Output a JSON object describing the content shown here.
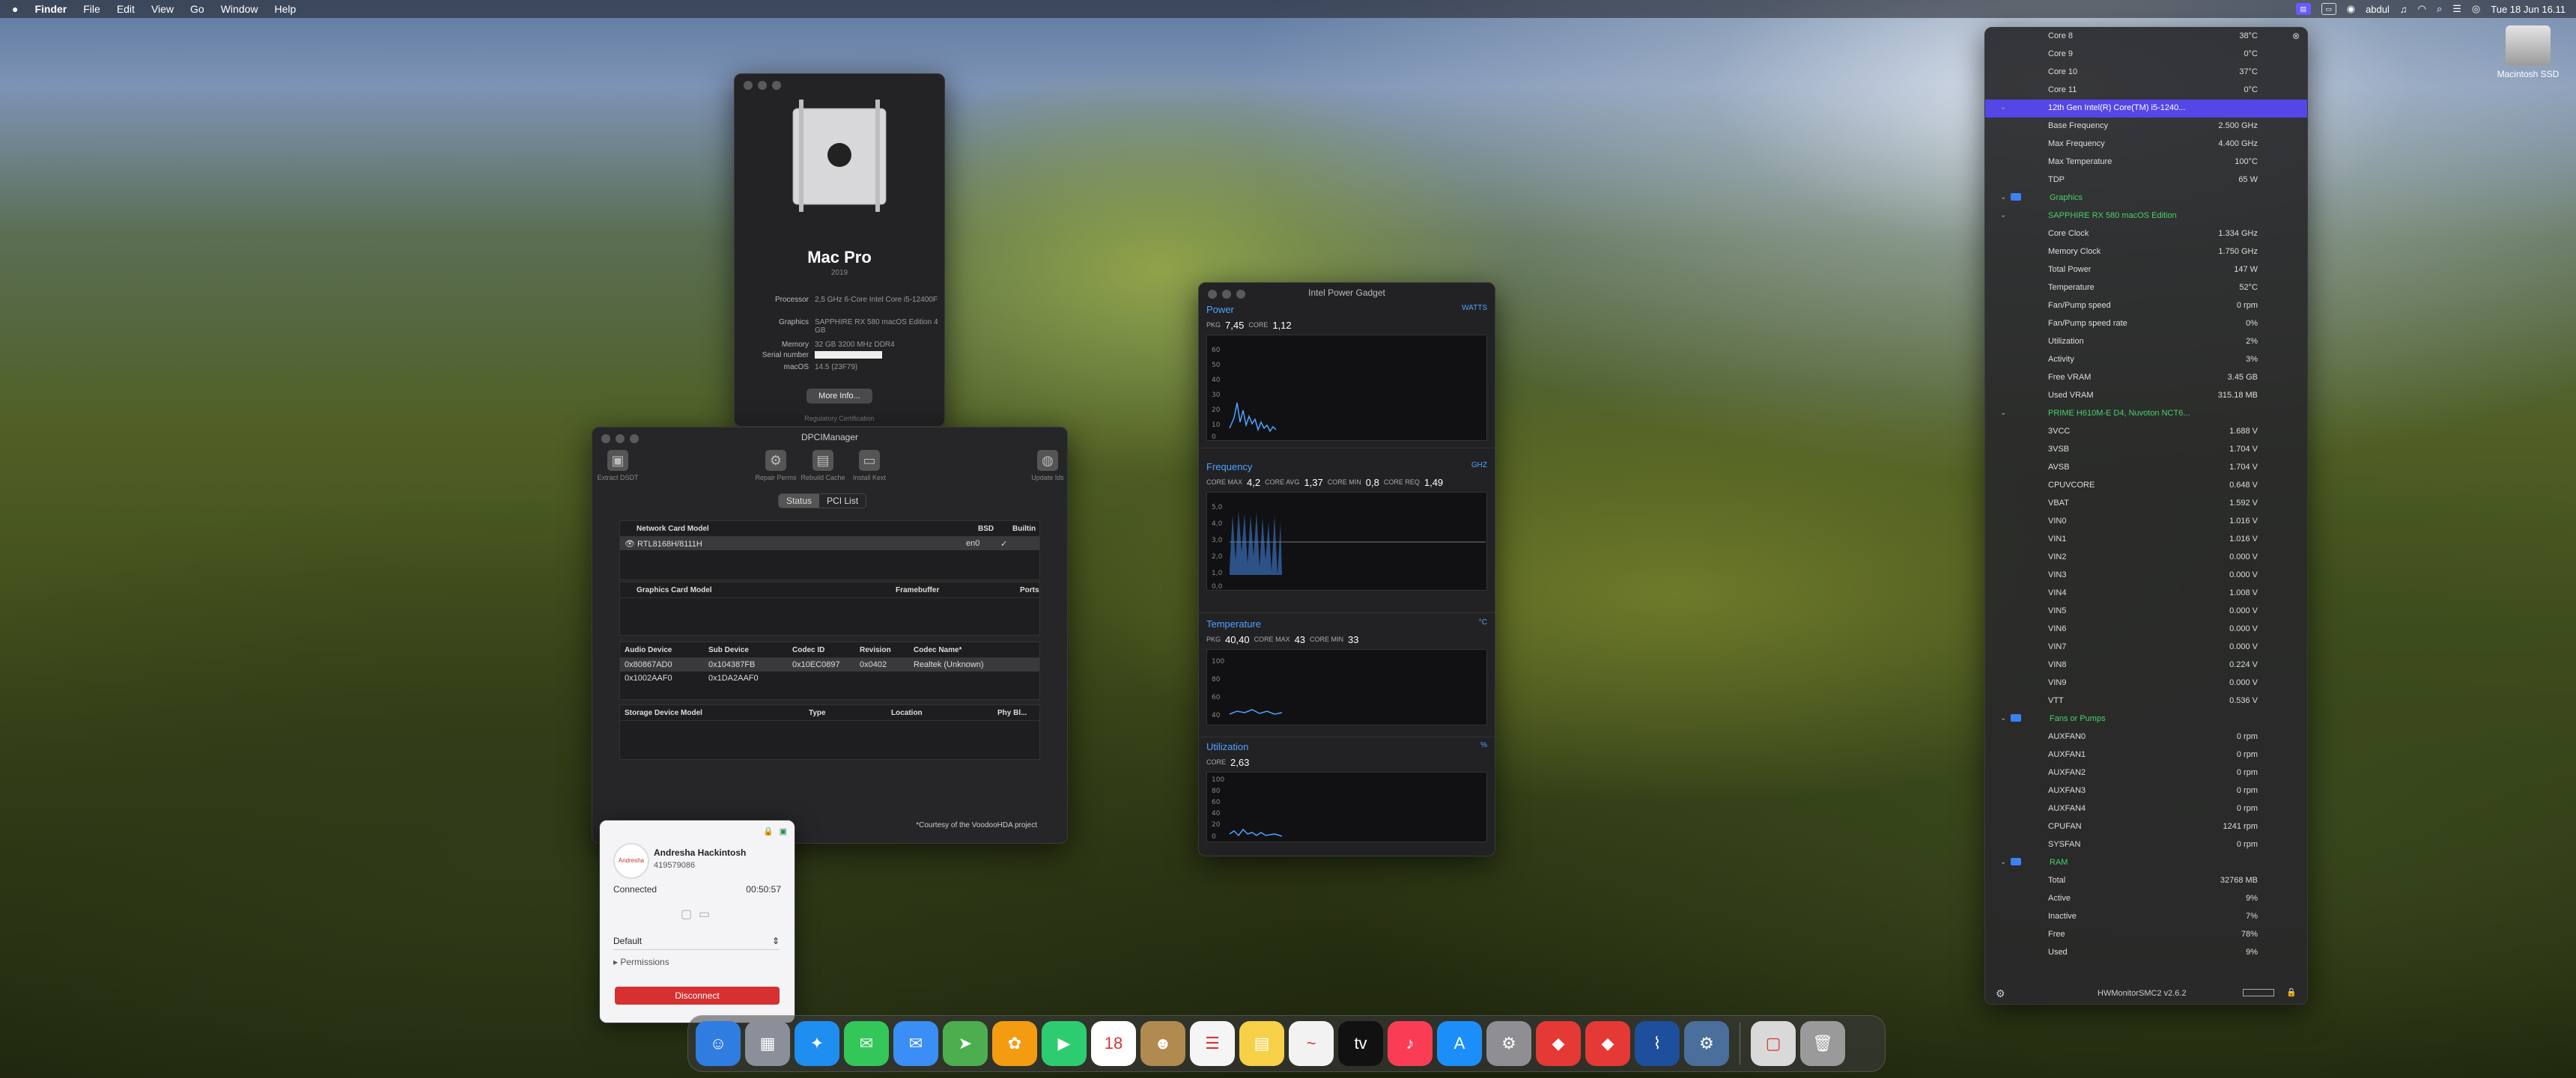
{
  "menubar": {
    "app": "Finder",
    "items": [
      "File",
      "Edit",
      "View",
      "Go",
      "Window",
      "Help"
    ],
    "user": "abdul",
    "clock": "Tue 18 Jun 16.11"
  },
  "desktop": {
    "disk_label": "Macintosh SSD"
  },
  "about": {
    "name": "Mac Pro",
    "year": "2019",
    "specs": [
      {
        "k": "Processor",
        "v": "2,5 GHz 6-Core Intel Core i5-12400F"
      },
      {
        "k": "Graphics",
        "v": "SAPPHIRE RX 580 macOS Edition 4 GB"
      },
      {
        "k": "Memory",
        "v": "32 GB 3200 MHz DDR4"
      },
      {
        "k": "Serial number",
        "v": ""
      },
      {
        "k": "macOS",
        "v": "14.5 (23F79)"
      }
    ],
    "more_info": "More Info...",
    "regulatory": "Regulatory Certification"
  },
  "dpci": {
    "title": "DPCIManager",
    "toolbar": [
      "Extract DSDT",
      "Repair Perms",
      "Rebuild Cache",
      "Install Kext",
      "Update Ids"
    ],
    "tabs": [
      "Status",
      "PCI List"
    ],
    "network": {
      "headers": [
        "Network Card Model",
        "BSD",
        "Builtin"
      ],
      "rows": [
        [
          "RTL8168H/8111H",
          "en0",
          "✓"
        ]
      ]
    },
    "graphics": {
      "headers": [
        "Graphics Card Model",
        "Framebuffer",
        "Ports"
      ]
    },
    "audio": {
      "headers": [
        "Audio Device",
        "Sub Device",
        "Codec ID",
        "Revision",
        "Codec Name*"
      ],
      "rows": [
        [
          "0x80867AD0",
          "0x104387FB",
          "0x10EC0897",
          "0x0402",
          "Realtek (Unknown)"
        ],
        [
          "0x1002AAF0",
          "0x1DA2AAF0",
          "",
          "",
          ""
        ]
      ]
    },
    "storage": {
      "headers": [
        "Storage Device Model",
        "Type",
        "Location",
        "Phy Bl..."
      ]
    },
    "courtesy": "*Courtesy of the VoodooHDA project"
  },
  "ipg": {
    "title": "Intel Power Gadget",
    "power": {
      "label": "Power",
      "unit": "WATTS",
      "pkg_label": "PKG",
      "pkg": "7,45",
      "core_label": "CORE",
      "core": "1,12",
      "yticks": [
        "60",
        "50",
        "40",
        "30",
        "20",
        "10",
        "0"
      ]
    },
    "freq": {
      "label": "Frequency",
      "unit": "GHZ",
      "pkg_label": "CORE MAX",
      "pkg": "4,2",
      "core_label": "CORE AVG",
      "core": "1,37",
      "min_label": "CORE MIN",
      "min": "0,8",
      "req_label": "CORE REQ",
      "req": "1,49",
      "yticks": [
        "5,0",
        "4,0",
        "3,0",
        "2,0",
        "1,0",
        "0,0"
      ]
    },
    "temp": {
      "label": "Temperature",
      "unit": "°C",
      "pkg_label": "PKG",
      "pkg": "40,40",
      "max_label": "CORE MAX",
      "max": "43",
      "min_label": "CORE MIN",
      "min": "33",
      "yticks": [
        "100",
        "80",
        "60",
        "40"
      ]
    },
    "util": {
      "label": "Utilization",
      "unit": "%",
      "core_label": "CORE",
      "core": "2,63",
      "yticks": [
        "100",
        "80",
        "60",
        "40",
        "20",
        "0"
      ]
    },
    "colors": {
      "accent": "#4da3ff"
    }
  },
  "hwm": {
    "footer": "HWMonitorSMC2 v2.6.2",
    "rows": [
      {
        "t": "item",
        "l": "Core 8",
        "v": "38°C"
      },
      {
        "t": "item",
        "l": "Core 9",
        "v": "0°C"
      },
      {
        "t": "item",
        "l": "Core 10",
        "v": "37°C"
      },
      {
        "t": "item",
        "l": "Core 11",
        "v": "0°C"
      },
      {
        "t": "hl",
        "l": "12th Gen Intel(R) Core(TM) i5-1240...",
        "v": ""
      },
      {
        "t": "item",
        "l": "Base Frequency",
        "v": "2.500 GHz"
      },
      {
        "t": "item",
        "l": "Max Frequency",
        "v": "4.400 GHz"
      },
      {
        "t": "item",
        "l": "Max Temperature",
        "v": "100°C"
      },
      {
        "t": "item",
        "l": "TDP",
        "v": "65 W"
      },
      {
        "t": "cat",
        "l": "Graphics",
        "v": ""
      },
      {
        "t": "sub",
        "l": "SAPPHIRE RX 580 macOS Edition",
        "v": ""
      },
      {
        "t": "item",
        "l": "Core Clock",
        "v": "1.334 GHz"
      },
      {
        "t": "item",
        "l": "Memory Clock",
        "v": "1.750 GHz"
      },
      {
        "t": "item",
        "l": "Total Power",
        "v": "147 W"
      },
      {
        "t": "item",
        "l": "Temperature",
        "v": "52°C"
      },
      {
        "t": "item",
        "l": "Fan/Pump speed",
        "v": "0 rpm"
      },
      {
        "t": "item",
        "l": "Fan/Pump speed rate",
        "v": "0%"
      },
      {
        "t": "item",
        "l": "Utilization",
        "v": "2%"
      },
      {
        "t": "item",
        "l": "Activity",
        "v": "3%"
      },
      {
        "t": "item",
        "l": "Free VRAM",
        "v": "3.45 GB"
      },
      {
        "t": "item",
        "l": "Used VRAM",
        "v": "315.18 MB"
      },
      {
        "t": "sub",
        "l": "PRIME H610M-E D4, Nuvoton NCT6...",
        "v": ""
      },
      {
        "t": "item",
        "l": "3VCC",
        "v": "1.688 V"
      },
      {
        "t": "item",
        "l": "3VSB",
        "v": "1.704 V"
      },
      {
        "t": "item",
        "l": "AVSB",
        "v": "1.704 V"
      },
      {
        "t": "item",
        "l": "CPUVCORE",
        "v": "0.648 V"
      },
      {
        "t": "item",
        "l": "VBAT",
        "v": "1.592 V"
      },
      {
        "t": "item",
        "l": "VIN0",
        "v": "1.016 V"
      },
      {
        "t": "item",
        "l": "VIN1",
        "v": "1.016 V"
      },
      {
        "t": "item",
        "l": "VIN2",
        "v": "0.000 V"
      },
      {
        "t": "item",
        "l": "VIN3",
        "v": "0.000 V"
      },
      {
        "t": "item",
        "l": "VIN4",
        "v": "1.008 V"
      },
      {
        "t": "item",
        "l": "VIN5",
        "v": "0.000 V"
      },
      {
        "t": "item",
        "l": "VIN6",
        "v": "0.000 V"
      },
      {
        "t": "item",
        "l": "VIN7",
        "v": "0.000 V"
      },
      {
        "t": "item",
        "l": "VIN8",
        "v": "0.224 V"
      },
      {
        "t": "item",
        "l": "VIN9",
        "v": "0.000 V"
      },
      {
        "t": "item",
        "l": "VTT",
        "v": "0.536 V"
      },
      {
        "t": "cat",
        "l": "Fans or Pumps",
        "v": ""
      },
      {
        "t": "item",
        "l": "AUXFAN0",
        "v": "0 rpm"
      },
      {
        "t": "item",
        "l": "AUXFAN1",
        "v": "0 rpm"
      },
      {
        "t": "item",
        "l": "AUXFAN2",
        "v": "0 rpm"
      },
      {
        "t": "item",
        "l": "AUXFAN3",
        "v": "0 rpm"
      },
      {
        "t": "item",
        "l": "AUXFAN4",
        "v": "0 rpm"
      },
      {
        "t": "item",
        "l": "CPUFAN",
        "v": "1241 rpm"
      },
      {
        "t": "item",
        "l": "SYSFAN",
        "v": "0 rpm"
      },
      {
        "t": "cat",
        "l": "RAM",
        "v": ""
      },
      {
        "t": "item",
        "l": "Total",
        "v": "32768 MB"
      },
      {
        "t": "item",
        "l": "Active",
        "v": "9%"
      },
      {
        "t": "item",
        "l": "Inactive",
        "v": "7%"
      },
      {
        "t": "item",
        "l": "Free",
        "v": "78%"
      },
      {
        "t": "item",
        "l": "Used",
        "v": "9%"
      }
    ]
  },
  "remote": {
    "name": "Andresha Hackintosh",
    "id": "419579086",
    "status": "Connected",
    "time": "00:50:57",
    "profile": "Default",
    "permissions": "Permissions",
    "disconnect": "Disconnect"
  },
  "dock": {
    "apps": [
      {
        "name": "finder-icon",
        "glyph": "☺",
        "color": "#2f7de1"
      },
      {
        "name": "launchpad-icon",
        "glyph": "▦",
        "color": "#8a8f99"
      },
      {
        "name": "safari-icon",
        "glyph": "✦",
        "color": "#1f8ef1"
      },
      {
        "name": "messages-icon",
        "glyph": "✉",
        "color": "#33c759"
      },
      {
        "name": "mail-icon",
        "glyph": "✉",
        "color": "#3a8ef6"
      },
      {
        "name": "maps-icon",
        "glyph": "➤",
        "color": "#4cae4f"
      },
      {
        "name": "photos-icon",
        "glyph": "✿",
        "color": "#f39c12"
      },
      {
        "name": "facetime-icon",
        "glyph": "▶",
        "color": "#2ecc71"
      },
      {
        "name": "calendar-icon",
        "glyph": "18",
        "color": "#ffffff"
      },
      {
        "name": "contacts-icon",
        "glyph": "☻",
        "color": "#b08a4f"
      },
      {
        "name": "reminders-icon",
        "glyph": "☰",
        "color": "#f5f5f5"
      },
      {
        "name": "notes-icon",
        "glyph": "▤",
        "color": "#f7d047"
      },
      {
        "name": "freeform-icon",
        "glyph": "~",
        "color": "#f2f2f2"
      },
      {
        "name": "appletv-icon",
        "glyph": "tv",
        "color": "#111111"
      },
      {
        "name": "music-icon",
        "glyph": "♪",
        "color": "#fa3d55"
      },
      {
        "name": "appstore-icon",
        "glyph": "A",
        "color": "#1c8ef9"
      },
      {
        "name": "settings-icon",
        "glyph": "⚙",
        "color": "#8e8e93"
      },
      {
        "name": "anydesk-icon",
        "glyph": "◆",
        "color": "#e53935"
      },
      {
        "name": "anydesk2-icon",
        "glyph": "◆",
        "color": "#e53935"
      },
      {
        "name": "powergadget-icon",
        "glyph": "⌇",
        "color": "#1e4f9c"
      },
      {
        "name": "utility-icon",
        "glyph": "⚙",
        "color": "#4b6f9c"
      }
    ],
    "right": [
      {
        "name": "documents-icon",
        "glyph": "▢",
        "color": "#d9d9d9"
      },
      {
        "name": "trash-icon",
        "glyph": "🗑",
        "color": "#9a9a9a"
      }
    ]
  }
}
